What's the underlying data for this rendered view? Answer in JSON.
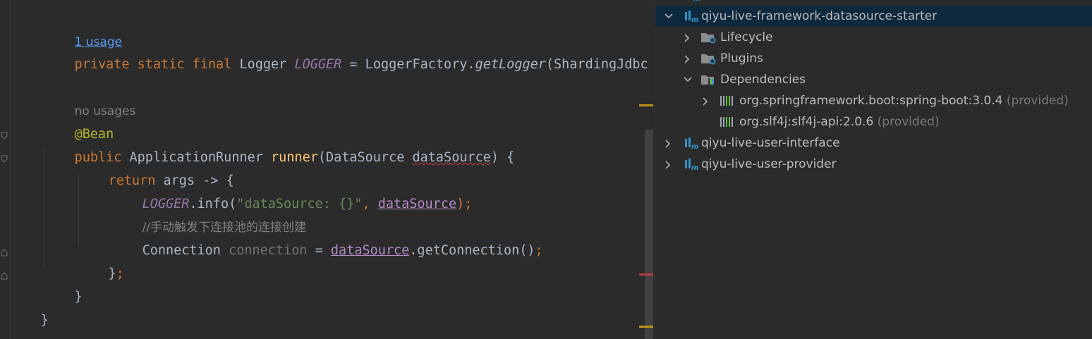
{
  "editor": {
    "hint_usage": "1 usage",
    "line_logger": {
      "kw": "private static final ",
      "type": "Logger ",
      "field": "LOGGER",
      "eq": " = LoggerFactory.",
      "method": "getLogger",
      "rest": "(ShardingJdbc"
    },
    "hint_no_usages": "no usages",
    "annotation": "@Bean",
    "line_sig": {
      "kw": "public ",
      "type": "ApplicationRunner ",
      "method": "runner",
      "open": "(DataSource ",
      "param": "dataSource",
      "close": ") {"
    },
    "line_return": {
      "kw": "return ",
      "rest": "args -> {"
    },
    "line_log": {
      "field": "LOGGER",
      "call": ".info(",
      "str": "\"dataSource: {}\"",
      "comma": ", ",
      "var": "dataSource",
      "end": ");"
    },
    "comment": "//手动触发下连接池的连接创建",
    "line_conn": {
      "type": "Connection ",
      "var": "connection",
      "eq": " = ",
      "ds": "dataSource",
      "call": ".getConnection()",
      "semi": ";"
    },
    "close_lambda": {
      "brace": "}",
      "semi": ";"
    },
    "close_method": "}",
    "close_class": "}"
  },
  "tree": {
    "rows": [
      {
        "label": "qiyu-live-framework-datasource-starter",
        "icon": "maven-module-icon",
        "chevron": "chevron-down-icon"
      },
      {
        "label": "Lifecycle",
        "icon": "folder-gear-icon",
        "chevron": "chevron-right-icon"
      },
      {
        "label": "Plugins",
        "icon": "folder-gear-icon",
        "chevron": "chevron-right-icon"
      },
      {
        "label": "Dependencies",
        "icon": "folder-library-icon",
        "chevron": "chevron-down-icon"
      },
      {
        "label": "org.springframework.boot:spring-boot:3.0.4",
        "suffix": " (provided)",
        "icon": "library-icon",
        "chevron": "chevron-right-icon"
      },
      {
        "label": "org.slf4j:slf4j-api:2.0.6",
        "suffix": " (provided)",
        "icon": "library-icon"
      },
      {
        "label": "qiyu-live-user-interface",
        "icon": "maven-module-icon",
        "chevron": "chevron-right-icon"
      },
      {
        "label": "qiyu-live-user-provider",
        "icon": "maven-module-icon",
        "chevron": "chevron-right-icon"
      }
    ]
  },
  "colors": {
    "background": "#2b2b2b",
    "keyword": "#cc7832",
    "field": "#9876aa",
    "method": "#ffc66d",
    "string": "#6a8759",
    "annotation": "#bbb529",
    "selection": "#0d293e"
  }
}
